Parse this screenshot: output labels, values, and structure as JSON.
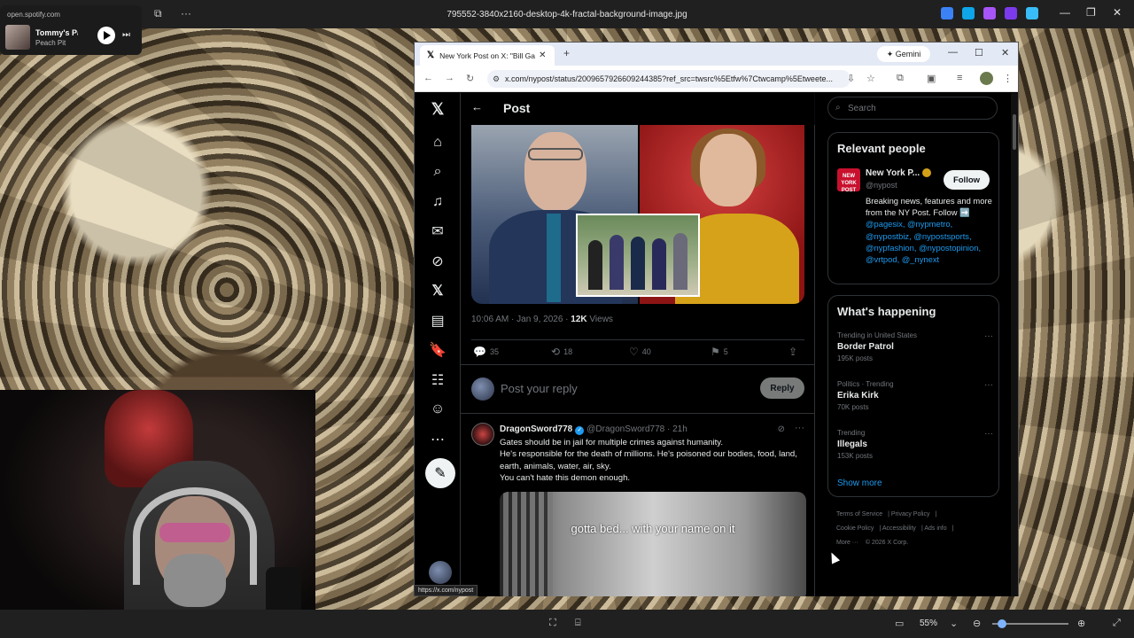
{
  "viewer": {
    "filename": "795552-3840x2160-desktop-4k-fractal-background-image.jpg",
    "zoom": "55%"
  },
  "spotify": {
    "domain": "open.spotify.com",
    "song": "Tommy's Pa",
    "artist": "Peach Pit"
  },
  "browser": {
    "tab_title": "New York Post on X: \"Bill Gates",
    "gemini_label": "Gemini",
    "url": "x.com/nypost/status/2009657926609244385?ref_src=twsrc%5Etfw%7Ctwcamp%5Etweete..."
  },
  "post": {
    "header_title": "Post",
    "timestamp": "10:06 AM · Jan 9, 2026 · ",
    "views_count": "12K",
    "views_label": " Views",
    "actions": {
      "replies": "35",
      "reposts": "18",
      "likes": "40",
      "bookmarks": "5"
    },
    "reply_placeholder": "Post your reply",
    "reply_button": "Reply"
  },
  "reply": {
    "name": "DragonSword778",
    "handle": "@DragonSword778 · 21h",
    "lines": [
      "Gates should be in jail for multiple crimes against humanity.",
      "He's responsible for the death of millions. He's poisoned our bodies, food, land, earth, animals, water, air, sky.",
      "You can't hate this demon enough."
    ],
    "gif_caption": "gotta bed... with your name on it"
  },
  "sidebar": {
    "search_placeholder": "Search",
    "relevant_title": "Relevant people",
    "person": {
      "name": "New York P...",
      "handle": "@nypost",
      "follow": "Follow",
      "bio_text": "Breaking news, features and more from the NY Post. Follow ➡️ ",
      "bio_links": "@pagesix, @nypmetro, @nypostbiz, @nypostsports, @nypfashion, @nypostopinion, @vrtpod, @_nynext",
      "logo_text": "NEW YORK POST"
    },
    "happening_title": "What's happening",
    "trends": [
      {
        "context": "Trending in United States",
        "title": "Border Patrol",
        "count": "195K posts"
      },
      {
        "context": "Politics · Trending",
        "title": "Erika Kirk",
        "count": "70K posts"
      },
      {
        "context": "Trending",
        "title": "Illegals",
        "count": "153K posts"
      }
    ],
    "show_more": "Show more",
    "footer": {
      "line1": [
        "Terms of Service",
        "Privacy Policy"
      ],
      "line2": [
        "Cookie Policy",
        "Accessibility",
        "Ads info"
      ],
      "line3": [
        "More ···",
        "© 2026 X Corp."
      ]
    }
  },
  "status_url": "https://x.com/nypost",
  "colors": {
    "accent": "#1d9bf0",
    "bg": "#000000",
    "border": "#2f3336"
  }
}
